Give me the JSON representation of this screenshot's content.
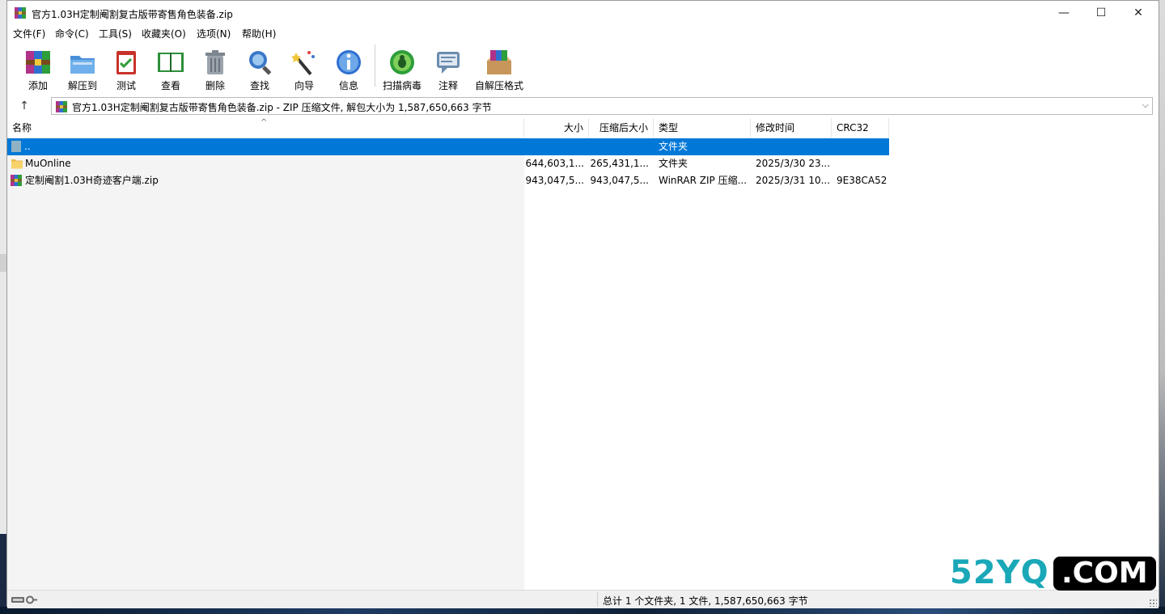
{
  "window": {
    "title": "官方1.03H定制阉割复古版带寄售角色装备.zip",
    "controls": [
      "—",
      "☐",
      "✕"
    ]
  },
  "menu": [
    "文件(F)",
    "命令(C)",
    "工具(S)",
    "收藏夹(O)",
    "选项(N)",
    "帮助(H)"
  ],
  "toolbar": [
    {
      "label": "添加",
      "icon": "add-archive-icon"
    },
    {
      "label": "解压到",
      "icon": "extract-to-icon"
    },
    {
      "label": "测试",
      "icon": "test-icon"
    },
    {
      "label": "查看",
      "icon": "view-icon"
    },
    {
      "label": "删除",
      "icon": "delete-icon"
    },
    {
      "label": "查找",
      "icon": "find-icon"
    },
    {
      "label": "向导",
      "icon": "wizard-icon"
    },
    {
      "label": "信息",
      "icon": "info-icon"
    },
    {
      "label": "扫描病毒",
      "icon": "virus-scan-icon"
    },
    {
      "label": "注释",
      "icon": "comment-icon"
    },
    {
      "label": "自解压格式",
      "icon": "sfx-icon"
    }
  ],
  "address": {
    "up": "↑",
    "path": "官方1.03H定制阉割复古版带寄售角色装备.zip - ZIP 压缩文件, 解包大小为 1,587,650,663 字节",
    "dropdown": "⌵"
  },
  "columns": {
    "name": "名称",
    "size": "大小",
    "packed": "压缩后大小",
    "type": "类型",
    "modified": "修改时间",
    "crc": "CRC32",
    "sort_indicator": "^"
  },
  "rows": [
    {
      "name": "..",
      "size": "",
      "packed": "",
      "type": "文件夹",
      "modified": "",
      "crc": "",
      "icon": "parent-folder-icon",
      "selected": true
    },
    {
      "name": "MuOnline",
      "size": "644,603,1...",
      "packed": "265,431,1...",
      "type": "文件夹",
      "modified": "2025/3/30 23...",
      "crc": "",
      "icon": "folder-icon",
      "selected": false
    },
    {
      "name": "定制阉割1.03H奇迹客户端.zip",
      "size": "943,047,5...",
      "packed": "943,047,5...",
      "type": "WinRAR ZIP 压缩...",
      "modified": "2025/3/31 10...",
      "crc": "9E38CA52",
      "icon": "winrar-archive-icon",
      "selected": false
    }
  ],
  "status": {
    "text": "总计 1 个文件夹, 1 文件, 1,587,650,663 字节"
  },
  "watermark": {
    "part1": "52YQ",
    "part2": ".COM"
  },
  "colors": {
    "selection": "#0078d7",
    "watermark": "#1aa8b8"
  }
}
